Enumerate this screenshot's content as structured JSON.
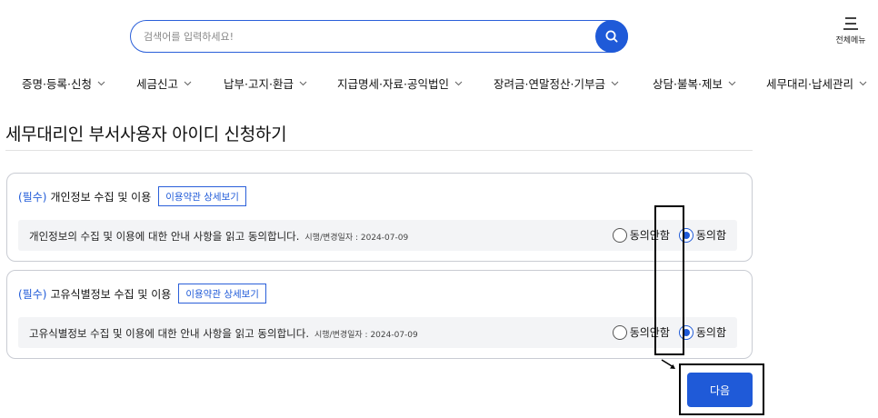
{
  "header": {
    "search_placeholder": "검색어를 입력하세요!",
    "search_value": "",
    "menu_label": "전체메뉴"
  },
  "nav": {
    "items": [
      {
        "label": "증명·등록·신청"
      },
      {
        "label": "세금신고"
      },
      {
        "label": "납부·고지·환급"
      },
      {
        "label": "지급명세·자료·공익법인"
      },
      {
        "label": "장려금·연말정산·기부금"
      },
      {
        "label": "상담·불복·제보"
      },
      {
        "label": "세무대리·납세관리"
      }
    ]
  },
  "page": {
    "title": "세무대리인 부서사용자 아이디 신청하기"
  },
  "agreements": [
    {
      "required": "(필수)",
      "title": "개인정보 수집 및 이용",
      "detail_button": "이용약관 상세보기",
      "text": "개인정보의 수집 및 이용에 대한 안내 사항을 읽고 동의합니다.",
      "date": "시행/변경일자 : 2024-07-09",
      "disagree_label": "동의안함",
      "agree_label": "동의함",
      "selected": "agree"
    },
    {
      "required": "(필수)",
      "title": "고유식별정보 수집 및 이용",
      "detail_button": "이용약관 상세보기",
      "text": "고유식별정보 수집 및 이용에 대한 안내 사항을 읽고 동의합니다.",
      "date": "시행/변경일자 : 2024-07-09",
      "disagree_label": "동의안함",
      "agree_label": "동의함",
      "selected": "agree"
    }
  ],
  "actions": {
    "next_label": "다음"
  },
  "colors": {
    "primary": "#1f5ad8",
    "border": "#c9ccd3",
    "body_bg": "#f3f4f6"
  }
}
